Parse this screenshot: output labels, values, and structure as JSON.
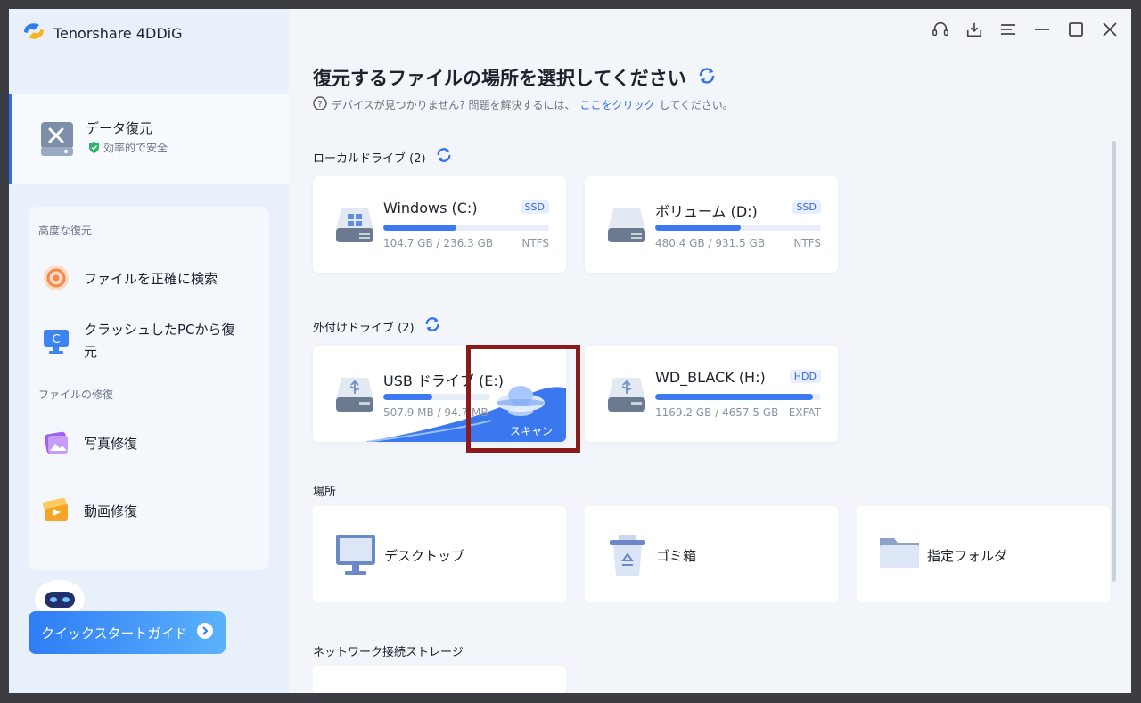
{
  "app": {
    "title": "Tenorshare 4DDiG"
  },
  "sidebar": {
    "active": {
      "title": "データ復元",
      "subtitle": "効率的で安全"
    },
    "sections": [
      {
        "label": "高度な復元"
      },
      {
        "label": "ファイルの修復"
      }
    ],
    "items": [
      {
        "label": "ファイルを正確に検索",
        "icon": "target-search-icon"
      },
      {
        "label": "クラッシュしたPCから復元",
        "label_line1": "クラッシュしたPCから復",
        "label_line2": "元",
        "icon": "crashed-pc-icon"
      },
      {
        "label": "写真修復",
        "icon": "photo-repair-icon"
      },
      {
        "label": "動画修復",
        "icon": "video-repair-icon"
      }
    ],
    "guide_button": "クイックスタートガイド"
  },
  "header": {
    "title": "復元するファイルの場所を選択してください",
    "help_prefix": "デバイスが見つかりません? 問題を解決するには、",
    "help_link": "ここをクリック",
    "help_suffix": "してください。"
  },
  "local_drives": {
    "title": "ローカルドライブ (2)",
    "drives": [
      {
        "name": "Windows (C:)",
        "badge": "SSD",
        "size": "104.7 GB / 236.3 GB",
        "fs": "NTFS",
        "usage": 0.443
      },
      {
        "name": "ボリューム (D:)",
        "badge": "SSD",
        "size": "480.4 GB / 931.5 GB",
        "fs": "NTFS",
        "usage": 0.516
      }
    ]
  },
  "external_drives": {
    "title": "外付けドライブ (2)",
    "drives": [
      {
        "name": "USB ドライブ (E:)",
        "size": "507.9 MB / 94.7 MB",
        "scan_label": "スキャン",
        "usage": 0.46
      },
      {
        "name": "WD_BLACK (H:)",
        "badge": "HDD",
        "size": "1169.2 GB / 4657.5 GB",
        "fs": "EXFAT",
        "usage": 0.95
      }
    ]
  },
  "locations": {
    "title": "場所",
    "items": [
      {
        "label": "デスクトップ",
        "icon": "desktop-icon"
      },
      {
        "label": "ゴミ箱",
        "icon": "recycle-bin-icon"
      },
      {
        "label": "指定フォルダ",
        "icon": "folder-icon"
      }
    ]
  },
  "network": {
    "title": "ネットワーク接続ストレージ"
  },
  "colors": {
    "accent": "#2f6ff0",
    "bar": "#3d7af2",
    "highlight": "#8b1a1a"
  }
}
